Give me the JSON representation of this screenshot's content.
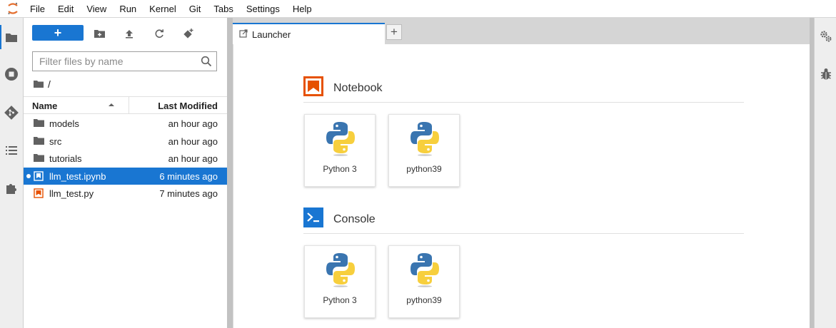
{
  "menu": [
    "File",
    "Edit",
    "View",
    "Run",
    "Kernel",
    "Git",
    "Tabs",
    "Settings",
    "Help"
  ],
  "sidebar_left": {
    "icons": [
      "folder-icon",
      "running-icon",
      "git-icon",
      "table-of-contents-icon",
      "extension-icon"
    ]
  },
  "filebrowser": {
    "new_label": "+",
    "filter_placeholder": "Filter files by name",
    "breadcrumb": "/",
    "columns": {
      "name": "Name",
      "modified": "Last Modified"
    },
    "files": [
      {
        "name": "models",
        "modified": "an hour ago",
        "type": "folder",
        "selected": false,
        "running": false
      },
      {
        "name": "src",
        "modified": "an hour ago",
        "type": "folder",
        "selected": false,
        "running": false
      },
      {
        "name": "tutorials",
        "modified": "an hour ago",
        "type": "folder",
        "selected": false,
        "running": false
      },
      {
        "name": "llm_test.ipynb",
        "modified": "6 minutes ago",
        "type": "notebook",
        "selected": true,
        "running": true
      },
      {
        "name": "llm_test.py",
        "modified": "7 minutes ago",
        "type": "python",
        "selected": false,
        "running": false
      }
    ]
  },
  "tabs": [
    {
      "label": "Launcher",
      "active": true
    }
  ],
  "tab_add_label": "+",
  "launcher": {
    "sections": [
      {
        "title": "Notebook",
        "icon": "notebook-icon",
        "kernels": [
          "Python 3",
          "python39"
        ]
      },
      {
        "title": "Console",
        "icon": "console-icon",
        "kernels": [
          "Python 3",
          "python39"
        ]
      }
    ]
  },
  "sidebar_right": {
    "icons": [
      "property-inspector-icon",
      "debugger-icon"
    ]
  },
  "colors": {
    "accent": "#1976d2",
    "notebook_orange": "#e65100",
    "folder": "#616161"
  }
}
